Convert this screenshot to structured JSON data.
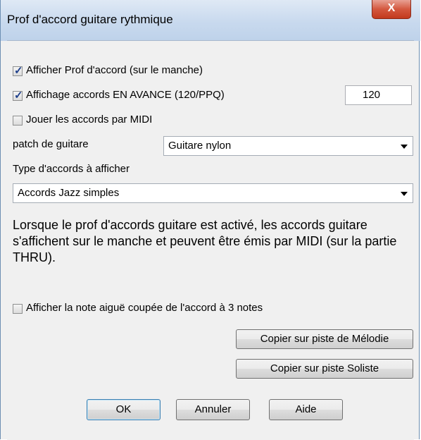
{
  "window": {
    "title": "Prof d'accord guitare rythmique",
    "close_label": "X"
  },
  "options": {
    "show_chord_tutor": {
      "label": "Afficher Prof d'accord (sur le manche)",
      "checked": true
    },
    "show_chords_ahead": {
      "label": "Affichage accords EN AVANCE (120/PPQ)",
      "checked": true,
      "value": "120"
    },
    "play_chords_midi": {
      "label": "Jouer les accords par MIDI",
      "checked": false
    }
  },
  "patch": {
    "label": "patch de guitare",
    "selected": "Guitare nylon"
  },
  "chord_type": {
    "label": "Type d'accords à afficher",
    "selected": "Accords Jazz simples"
  },
  "description": "Lorsque le prof d'accords guitare est activé, les accords guitare s'affichent sur le manche et peuvent être émis par MIDI (sur la partie THRU).",
  "show_high_note": {
    "label": "Afficher la note aiguë coupée de l'accord à 3 notes",
    "checked": false
  },
  "buttons": {
    "copy_melody": "Copier sur piste de Mélodie",
    "copy_soloist": "Copier sur piste Soliste",
    "ok": "OK",
    "cancel": "Annuler",
    "help": "Aide"
  }
}
